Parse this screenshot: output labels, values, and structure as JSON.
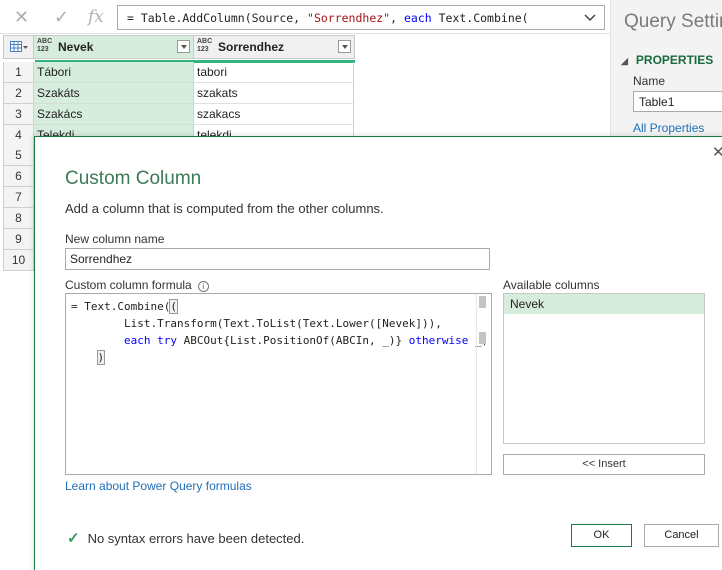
{
  "formula_bar": {
    "cancel_icon": "close-icon",
    "commit_icon": "check-icon",
    "fx_label": "fx",
    "text_prefix": "= Table.AddColumn(Source, ",
    "text_string": "\"Sorrendhez\"",
    "text_mid": ", ",
    "text_keyword": "each",
    "text_suffix": " Text.Combine("
  },
  "query_settings": {
    "title": "Query Settin",
    "properties_label": "PROPERTIES",
    "name_label": "Name",
    "name_value": "Table1",
    "all_properties": "All Properties"
  },
  "grid": {
    "columns": [
      {
        "type_badge": "ABC\n123",
        "name": "Nevek"
      },
      {
        "type_badge": "ABC\n123",
        "name": "Sorrendhez"
      }
    ],
    "rows": [
      {
        "num": "1",
        "c1": "Tábori",
        "c2": "tabori"
      },
      {
        "num": "2",
        "c1": "Szakáts",
        "c2": "szakats"
      },
      {
        "num": "3",
        "c1": "Szakács",
        "c2": "szakacs"
      },
      {
        "num": "4",
        "c1": "Telekdi",
        "c2": "telekdi"
      }
    ],
    "more_row_numbers": [
      "5",
      "6",
      "7",
      "8",
      "9",
      "10"
    ]
  },
  "dialog": {
    "title": "Custom Column",
    "subtitle": "Add a column that is computed from the other columns.",
    "new_column_label": "New column name",
    "new_column_value": "Sorrendhez",
    "formula_label": "Custom column formula",
    "formula_lines": {
      "l1": "= Text.Combine(",
      "l2": "        List.Transform(Text.ToList(Text.Lower([Nevek])),",
      "l3_kw1": "each",
      "l3_kw2": "try",
      "l3_mid": " ABCOut{List.PositionOf(ABCIn, _)} ",
      "l3_kw3": "otherwise",
      "l3_end": " _)",
      "l4": ")"
    },
    "available_label": "Available columns",
    "available_items": [
      "Nevek"
    ],
    "insert_label": "<< Insert",
    "learn_link": "Learn about Power Query formulas",
    "status": "No syntax errors have been detected.",
    "ok_label": "OK",
    "cancel_label": "Cancel"
  }
}
